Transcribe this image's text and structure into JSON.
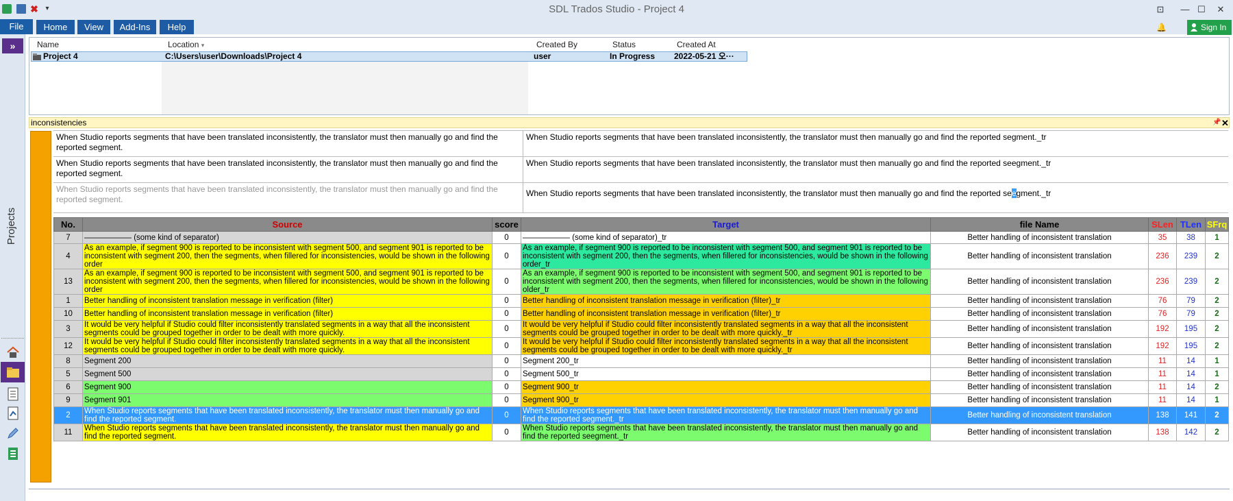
{
  "window": {
    "title": "SDL Trados Studio - Project 4"
  },
  "ribbon": {
    "tabs": [
      "File",
      "Home",
      "View",
      "Add-Ins",
      "Help"
    ],
    "sign_in": "Sign In"
  },
  "rail": {
    "toggle": "»",
    "label": "Projects"
  },
  "projects": {
    "headers": [
      "Name",
      "Location",
      "Created By",
      "Status",
      "Created At"
    ],
    "row": {
      "name": "Project 4",
      "location": "C:\\Users\\user\\Downloads\\Project 4",
      "created_by": "user",
      "status": "In Progress",
      "created_at": "2022-05-21 오···"
    }
  },
  "panel": {
    "title": "inconsistencies",
    "comparisons": [
      {
        "source": "When Studio reports segments that have been translated inconsistently, the translator must then manually go and find the reported segment.",
        "target": "When Studio reports segments that have been translated inconsistently, the translator must then manually go and find the reported segment._tr"
      },
      {
        "source": "When Studio reports segments that have been translated inconsistently, the translator must then manually go and find the reported segment.",
        "target": "When Studio reports segments that have been translated inconsistently, the translator must then manually go and find the reported seegment._tr"
      },
      {
        "source": "When Studio reports segments that have been translated inconsistently, the translator must then manually go and find the reported segment.",
        "target_pre": "When Studio reports segments that have been translated inconsistently, the translator must then manually go and find the reported se",
        "target_caret": "e",
        "target_post": "gment._tr"
      }
    ]
  },
  "grid": {
    "headers": {
      "no": "No.",
      "source": "Source",
      "score": "score",
      "target": "Target",
      "file": "file Name",
      "slen": "SLen",
      "tlen": "TLen",
      "sfrq": "SFrq"
    },
    "header_colors": {
      "source": "#d00000",
      "target": "#1a1ad0",
      "slen": "#ff2020",
      "tlen": "#2030ff",
      "sfrq": "#ffff00"
    },
    "rows": [
      {
        "no": "7",
        "source": "―――――― (some kind of separator)",
        "score": "0",
        "target": "―――――― (some kind of separator)_tr",
        "file": "Better handling of inconsistent translation",
        "slen": "35",
        "tlen": "38",
        "sfrq": "1",
        "sbg": "bg-gr",
        "tbg": "bg-w",
        "h": 18
      },
      {
        "no": "4",
        "source": "As an example, if segment 900 is reported to be inconsistent with segment 500, and segment 901 is reported to be inconsistent with segment 200, then the segments, when fillered for inconsistencies, would be shown in the following order",
        "score": "0",
        "target": "As an example, if segment 900 is reported to be inconsistent with segment 500, and segment 901 is reported to be inconsistent with segment 200, then the segments, when fillered for inconsistencies, would be shown in the following order_tr",
        "file": "Better handling of inconsistent translation",
        "slen": "236",
        "tlen": "239",
        "sfrq": "2",
        "sbg": "bg-y",
        "tbg": "bg-t",
        "h": 37
      },
      {
        "no": "13",
        "source": "As an example, if segment 900 is reported to be inconsistent with segment 500, and segment 901 is reported to be inconsistent with segment 200, then the segments, when fillered for inconsistencies, would be shown in the following order",
        "score": "0",
        "target": "As an example, if segment 900 is reported to be inconsistent with segment 500, and segment 901 is reported to be inconsistent with segment 200, then the segments, when fillered for inconsistencies, would be shown in the following older_tr",
        "file": "Better handling of inconsistent translation",
        "slen": "236",
        "tlen": "239",
        "sfrq": "2",
        "sbg": "bg-y",
        "tbg": "bg-g",
        "h": 37
      },
      {
        "no": "1",
        "source": "Better handling of inconsistent translation message in verification (filter)",
        "score": "0",
        "target": "Better handling of inconsistent translation message in verification (filter)_tr",
        "file": "Better handling of inconsistent translation",
        "slen": "76",
        "tlen": "79",
        "sfrq": "2",
        "sbg": "bg-y",
        "tbg": "bg-o",
        "h": 19
      },
      {
        "no": "10",
        "source": "Better handling of inconsistent translation message in verification (filter)",
        "score": "0",
        "target": "Better handling of inconsistent translation message in verification (filter)_tr",
        "file": "Better handling of inconsistent translation",
        "slen": "76",
        "tlen": "79",
        "sfrq": "2",
        "sbg": "bg-y",
        "tbg": "bg-o",
        "h": 19
      },
      {
        "no": "3",
        "source": "It would be very helpful if Studio could filter inconsistently translated segments in a way that all the inconsistent segments could be grouped together in order to be dealt with more quickly.",
        "score": "0",
        "target": "It would be very helpful if Studio could filter inconsistently translated segments in a way that all the inconsistent segments could be grouped together in order to be dealt with more quickly._tr",
        "file": "Better handling of inconsistent translation",
        "slen": "192",
        "tlen": "195",
        "sfrq": "2",
        "sbg": "bg-y",
        "tbg": "bg-o",
        "h": 25
      },
      {
        "no": "12",
        "source": "It would be very helpful if Studio could filter inconsistently translated segments in a way that all the inconsistent segments could be grouped together in order to be dealt with more quickly.",
        "score": "0",
        "target": "It would be very helpful if Studio could filter inconsistently translated segments in a way that all the inconsistent segments could be grouped together in order to be dealt with more quickly._tr",
        "file": "Better handling of inconsistent translation",
        "slen": "192",
        "tlen": "195",
        "sfrq": "2",
        "sbg": "bg-y",
        "tbg": "bg-o",
        "h": 25
      },
      {
        "no": "8",
        "source": "Segment 200",
        "score": "0",
        "target": "Segment 200_tr",
        "file": "Better handling of inconsistent translation",
        "slen": "11",
        "tlen": "14",
        "sfrq": "1",
        "sbg": "bg-gr",
        "tbg": "bg-w",
        "h": 19
      },
      {
        "no": "5",
        "source": "Segment 500",
        "score": "0",
        "target": "Segment 500_tr",
        "file": "Better handling of inconsistent translation",
        "slen": "11",
        "tlen": "14",
        "sfrq": "1",
        "sbg": "bg-gr",
        "tbg": "bg-w",
        "h": 19
      },
      {
        "no": "6",
        "source": "Segment 900",
        "score": "0",
        "target": "Segment 900_tr",
        "file": "Better handling of inconsistent translation",
        "slen": "11",
        "tlen": "14",
        "sfrq": "2",
        "sbg": "bg-g",
        "tbg": "bg-o",
        "h": 19
      },
      {
        "no": "9",
        "source": "Segment 901",
        "score": "0",
        "target": "Segment 900_tr",
        "file": "Better handling of inconsistent translation",
        "slen": "11",
        "tlen": "14",
        "sfrq": "1",
        "sbg": "bg-g",
        "tbg": "bg-o",
        "h": 19
      },
      {
        "no": "2",
        "source": "When Studio reports segments that have been translated inconsistently, the translator must then manually go and find the reported segment.",
        "score": "0",
        "target": "When Studio reports segments that have been translated inconsistently, the translator must then manually go and find the reported segment._tr",
        "file": "Better handling of inconsistent translation",
        "slen": "138",
        "tlen": "141",
        "sfrq": "2",
        "sbg": "bg-y",
        "tbg": "bg-o",
        "h": 25,
        "selected": true
      },
      {
        "no": "11",
        "source": "When Studio reports segments that have been translated inconsistently, the translator must then manually go and find the reported segment.",
        "score": "0",
        "target": "When Studio reports segments that have been translated inconsistently, the translator must then manually go and find the reported seegment._tr",
        "file": "Better handling of inconsistent translation",
        "slen": "138",
        "tlen": "142",
        "sfrq": "2",
        "sbg": "bg-y",
        "tbg": "bg-g",
        "h": 25
      }
    ]
  },
  "colors": {
    "accent": "#1d5ba5",
    "rail_active": "#5a2f8c",
    "panel_bar": "#f5a100",
    "selection": "#3399ff"
  }
}
